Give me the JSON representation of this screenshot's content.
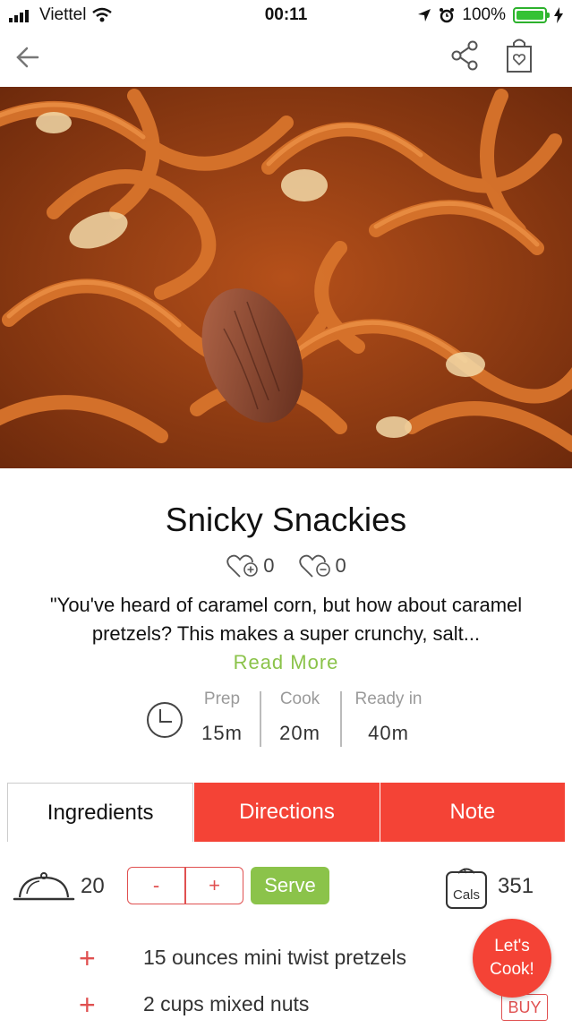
{
  "status": {
    "carrier": "Viettel",
    "time": "00:11",
    "battery": "100%"
  },
  "recipe": {
    "title": "Snicky Snackies",
    "likes": "0",
    "dislikes": "0",
    "description": "\"You've heard of caramel corn, but how about caramel pretzels? This makes a super crunchy, salt...",
    "read_more": "Read More"
  },
  "times": {
    "prep_label": "Prep",
    "prep_value": "15m",
    "cook_label": "Cook",
    "cook_value": "20m",
    "ready_label": "Ready in",
    "ready_value": "40m"
  },
  "tabs": [
    {
      "label": "Ingredients"
    },
    {
      "label": "Directions"
    },
    {
      "label": "Note"
    }
  ],
  "servings": {
    "count": "20",
    "minus": "-",
    "plus": "+",
    "serve_label": "Serve",
    "cals_icon_text": "Cals",
    "calories": "351"
  },
  "ingredients": [
    {
      "text": "15 ounces mini twist pretzels"
    },
    {
      "text": "2 cups mixed nuts",
      "buy": "BUY"
    }
  ],
  "fab": {
    "line1": "Let's",
    "line2": "Cook!"
  },
  "colors": {
    "accent_red": "#f44336",
    "accent_green": "#8bc34a"
  },
  "icons": [
    "signal-icon",
    "wifi-icon",
    "location-icon",
    "alarm-icon",
    "battery-icon",
    "charging-icon",
    "back-arrow-icon",
    "share-icon",
    "shopping-bag-icon",
    "heart-plus-icon",
    "heart-minus-icon",
    "clock-icon",
    "cloche-icon",
    "scale-icon",
    "plus-icon"
  ]
}
